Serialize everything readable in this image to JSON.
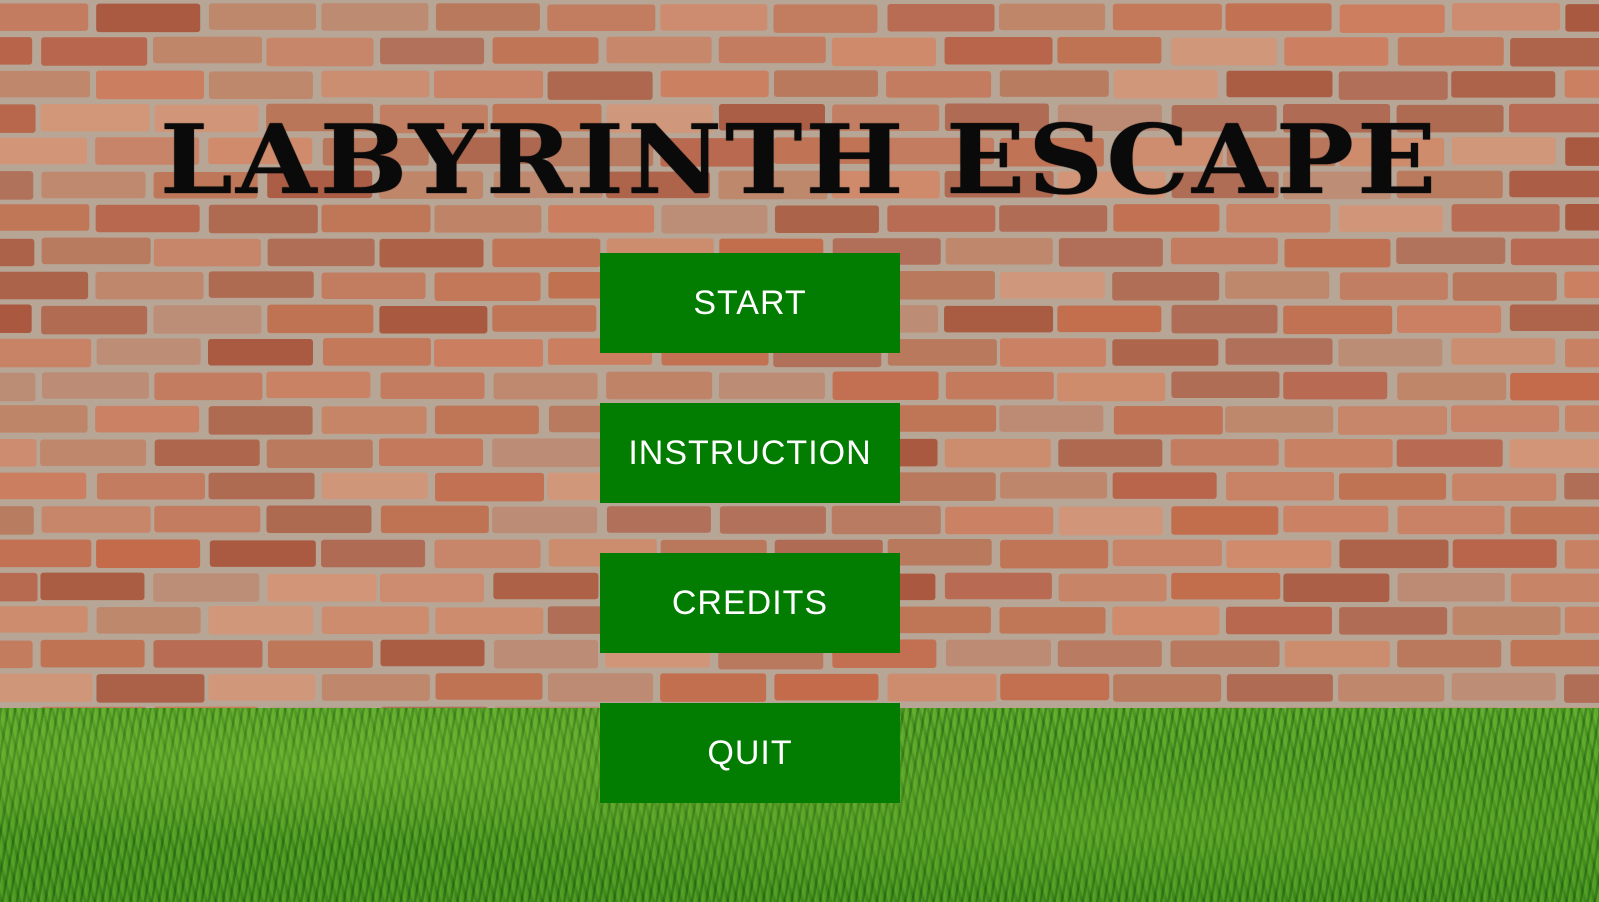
{
  "title": "LABYRINTH ESCAPE",
  "menu": {
    "items": [
      {
        "label": "START"
      },
      {
        "label": "INSTRUCTION"
      },
      {
        "label": "CREDITS"
      },
      {
        "label": "QUIT"
      }
    ]
  },
  "colors": {
    "button_bg": "#027d02",
    "button_text": "#ffffff",
    "title_text": "#0a0a0a",
    "mortar": "#b7a596",
    "grass": "#3f8f1c"
  },
  "scene": {
    "background_top": "brick-wall",
    "background_bottom": "grass-field"
  }
}
